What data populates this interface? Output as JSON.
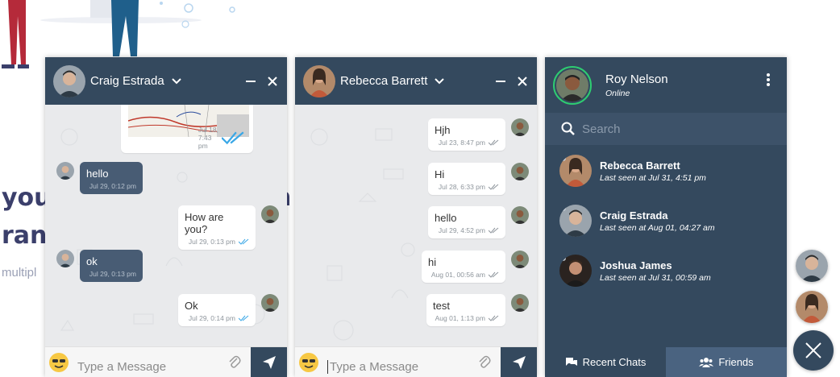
{
  "background": {
    "heading_line1": "you",
    "heading_line2": "ranc",
    "heading_right": "n",
    "subtext": "multipl"
  },
  "chat1": {
    "contact_name": "Craig Estrada",
    "map_time": "Jul 18, 7:43 pm",
    "messages": [
      {
        "dir": "in",
        "text": "hello",
        "time": "Jul 29, 0:12 pm"
      },
      {
        "dir": "out",
        "text": "How are you?",
        "time": "Jul 29, 0:13 pm"
      },
      {
        "dir": "in",
        "text": "ok",
        "time": "Jul 29, 0:13 pm"
      },
      {
        "dir": "out",
        "text": "Ok",
        "time": "Jul 29, 0:14 pm"
      }
    ],
    "input_placeholder": "Type a Message"
  },
  "chat2": {
    "contact_name": "Rebecca Barrett",
    "messages": [
      {
        "dir": "out",
        "text": "Hjh",
        "time": "Jul 23, 8:47 pm"
      },
      {
        "dir": "out",
        "text": "Hi",
        "time": "Jul 28, 6:33 pm"
      },
      {
        "dir": "out",
        "text": "hello",
        "time": "Jul 29, 4:52 pm"
      },
      {
        "dir": "out",
        "text": "hi",
        "time": "Aug 01, 00:56 am"
      },
      {
        "dir": "out",
        "text": "test",
        "time": "Aug 01, 1:13 pm"
      }
    ],
    "input_placeholder": "Type a Message"
  },
  "panel": {
    "user_name": "Roy Nelson",
    "user_status": "Online",
    "search_placeholder": "Search",
    "contacts": [
      {
        "name": "Rebecca Barrett",
        "last_seen": "Last seen at Jul 31, 4:51 pm"
      },
      {
        "name": "Craig Estrada",
        "last_seen": "Last seen at Aug 01, 04:27 am"
      },
      {
        "name": "Joshua James",
        "last_seen": "Last seen at Jul 31, 00:59 am"
      }
    ],
    "tabs": {
      "recent": "Recent Chats",
      "friends": "Friends"
    }
  },
  "colors": {
    "header": "#34495e",
    "incoming_bubble": "#485c74",
    "online_ring": "#2ecc71",
    "read_ticks": "#3aa7e6"
  }
}
